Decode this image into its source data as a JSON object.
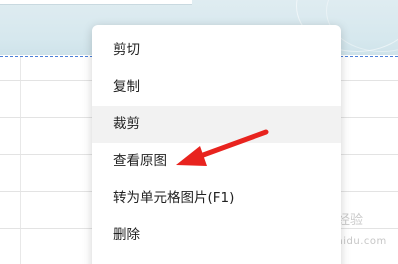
{
  "context_menu": {
    "items": [
      {
        "label": "剪切"
      },
      {
        "label": "复制"
      },
      {
        "label": "裁剪"
      },
      {
        "label": "查看原图"
      },
      {
        "label": "转为单元格图片(F1)"
      },
      {
        "label": "删除"
      }
    ],
    "hovered_index": 2
  },
  "annotation": {
    "arrow_color": "#e8231e"
  },
  "watermark": {
    "text": "jingyan.baidu.com"
  },
  "colors": {
    "menu_hover": "#f2f2f2",
    "selection_dashed": "#4a7fd8",
    "header_band": "#d6e8ee"
  }
}
